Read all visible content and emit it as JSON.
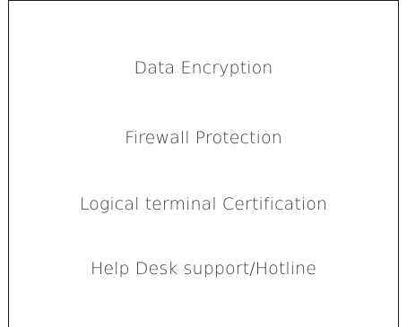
{
  "features": {
    "items": [
      {
        "label": "Data Encryption"
      },
      {
        "label": "Firewall Protection"
      },
      {
        "label": "Logical terminal Certification"
      },
      {
        "label": "Help Desk support/Hotline"
      }
    ]
  },
  "colors": {
    "text": "#3a3a3a",
    "border": "#1a1a1a",
    "background": "#ffffff"
  }
}
